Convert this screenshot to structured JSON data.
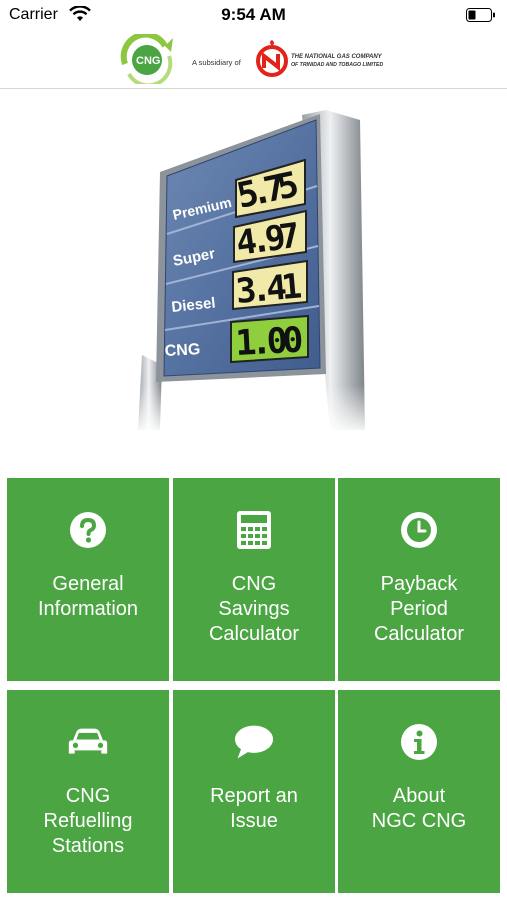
{
  "status_bar": {
    "carrier": "Carrier",
    "time": "9:54 AM"
  },
  "header": {
    "cng_logo_text": "CNG",
    "subsidiary_text": "A subsidiary of",
    "ngc_name_line1": "THE NATIONAL GAS COMPANY",
    "ngc_name_line2": "OF TRINIDAD AND TOBAGO LIMITED"
  },
  "price_sign": {
    "rows": [
      {
        "label": "Premium",
        "price": "5.75",
        "color": "#f1e9a8"
      },
      {
        "label": "Super",
        "price": "4.97",
        "color": "#f1e9a8"
      },
      {
        "label": "Diesel",
        "price": "3.41",
        "color": "#f1e9a8"
      },
      {
        "label": "CNG",
        "price": "1.00",
        "color": "#8fcf3e"
      }
    ]
  },
  "menu": {
    "tile_color": "#4aa542",
    "items": [
      {
        "label": "General\nInformation",
        "icon": "question-circle-icon"
      },
      {
        "label": "CNG\nSavings\nCalculator",
        "icon": "calculator-icon"
      },
      {
        "label": "Payback\nPeriod\nCalculator",
        "icon": "clock-icon"
      },
      {
        "label": "CNG\nRefuelling\nStations",
        "icon": "car-icon"
      },
      {
        "label": "Report an\nIssue",
        "icon": "chat-bubble-icon"
      },
      {
        "label": "About\nNGC CNG",
        "icon": "info-circle-icon"
      }
    ]
  }
}
